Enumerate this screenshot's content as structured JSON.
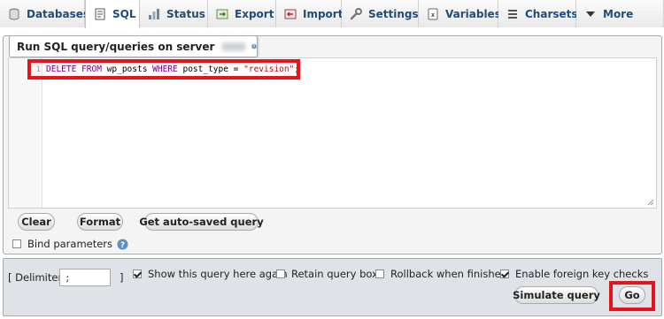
{
  "tabs": [
    {
      "label": "Databases",
      "icon": "database-icon",
      "active": false
    },
    {
      "label": "SQL",
      "icon": "sql-icon",
      "active": true
    },
    {
      "label": "Status",
      "icon": "status-icon",
      "active": false
    },
    {
      "label": "Export",
      "icon": "export-icon",
      "active": false
    },
    {
      "label": "Import",
      "icon": "import-icon",
      "active": false
    },
    {
      "label": "Settings",
      "icon": "wrench-icon",
      "active": false
    },
    {
      "label": "Variables",
      "icon": "variables-icon",
      "active": false
    },
    {
      "label": "Charsets",
      "icon": "charsets-icon",
      "active": false
    },
    {
      "label": "More",
      "icon": "triangle-down-icon",
      "active": false
    }
  ],
  "panel": {
    "legend": "Run SQL query/queries on server"
  },
  "editor": {
    "line_number": "1",
    "kw1": "DELETE",
    "kw2": "FROM",
    "table": " wp_posts ",
    "kw3": "WHERE",
    "condition": " post_type = ",
    "value": "\"revision\"",
    "end": ";"
  },
  "buttons": {
    "clear": "Clear",
    "format": "Format",
    "autosaved": "Get auto-saved query",
    "simulate": "Simulate query",
    "go": "Go"
  },
  "bind_parameters": {
    "label": "Bind parameters",
    "checked": false
  },
  "footer": {
    "delimiter_label": "[ Delimiter",
    "delimiter_value": ";",
    "delimiter_close": "]",
    "options": [
      {
        "label": "Show this query here again",
        "checked": true
      },
      {
        "label": "Retain query box",
        "checked": false
      },
      {
        "label": "Rollback when finished",
        "checked": false
      },
      {
        "label": "Enable foreign key checks",
        "checked": true
      }
    ]
  },
  "colors": {
    "highlight": "#e8141c",
    "tab_text": "#1f4c79",
    "keyword": "#770088",
    "string": "#aa1111"
  }
}
